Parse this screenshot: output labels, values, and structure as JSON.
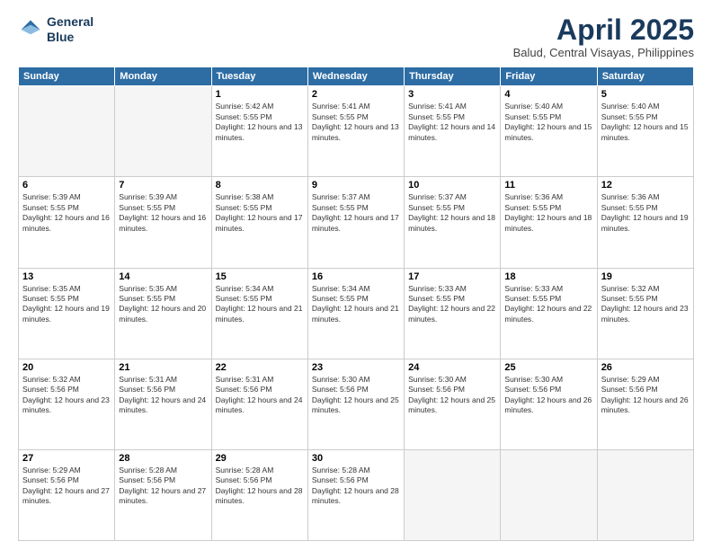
{
  "header": {
    "logo_line1": "General",
    "logo_line2": "Blue",
    "title": "April 2025",
    "subtitle": "Balud, Central Visayas, Philippines"
  },
  "calendar": {
    "days_of_week": [
      "Sunday",
      "Monday",
      "Tuesday",
      "Wednesday",
      "Thursday",
      "Friday",
      "Saturday"
    ],
    "weeks": [
      [
        {
          "day": "",
          "sunrise": "",
          "sunset": "",
          "daylight": "",
          "empty": true
        },
        {
          "day": "",
          "sunrise": "",
          "sunset": "",
          "daylight": "",
          "empty": true
        },
        {
          "day": "1",
          "sunrise": "Sunrise: 5:42 AM",
          "sunset": "Sunset: 5:55 PM",
          "daylight": "Daylight: 12 hours and 13 minutes.",
          "empty": false
        },
        {
          "day": "2",
          "sunrise": "Sunrise: 5:41 AM",
          "sunset": "Sunset: 5:55 PM",
          "daylight": "Daylight: 12 hours and 13 minutes.",
          "empty": false
        },
        {
          "day": "3",
          "sunrise": "Sunrise: 5:41 AM",
          "sunset": "Sunset: 5:55 PM",
          "daylight": "Daylight: 12 hours and 14 minutes.",
          "empty": false
        },
        {
          "day": "4",
          "sunrise": "Sunrise: 5:40 AM",
          "sunset": "Sunset: 5:55 PM",
          "daylight": "Daylight: 12 hours and 15 minutes.",
          "empty": false
        },
        {
          "day": "5",
          "sunrise": "Sunrise: 5:40 AM",
          "sunset": "Sunset: 5:55 PM",
          "daylight": "Daylight: 12 hours and 15 minutes.",
          "empty": false
        }
      ],
      [
        {
          "day": "6",
          "sunrise": "Sunrise: 5:39 AM",
          "sunset": "Sunset: 5:55 PM",
          "daylight": "Daylight: 12 hours and 16 minutes.",
          "empty": false
        },
        {
          "day": "7",
          "sunrise": "Sunrise: 5:39 AM",
          "sunset": "Sunset: 5:55 PM",
          "daylight": "Daylight: 12 hours and 16 minutes.",
          "empty": false
        },
        {
          "day": "8",
          "sunrise": "Sunrise: 5:38 AM",
          "sunset": "Sunset: 5:55 PM",
          "daylight": "Daylight: 12 hours and 17 minutes.",
          "empty": false
        },
        {
          "day": "9",
          "sunrise": "Sunrise: 5:37 AM",
          "sunset": "Sunset: 5:55 PM",
          "daylight": "Daylight: 12 hours and 17 minutes.",
          "empty": false
        },
        {
          "day": "10",
          "sunrise": "Sunrise: 5:37 AM",
          "sunset": "Sunset: 5:55 PM",
          "daylight": "Daylight: 12 hours and 18 minutes.",
          "empty": false
        },
        {
          "day": "11",
          "sunrise": "Sunrise: 5:36 AM",
          "sunset": "Sunset: 5:55 PM",
          "daylight": "Daylight: 12 hours and 18 minutes.",
          "empty": false
        },
        {
          "day": "12",
          "sunrise": "Sunrise: 5:36 AM",
          "sunset": "Sunset: 5:55 PM",
          "daylight": "Daylight: 12 hours and 19 minutes.",
          "empty": false
        }
      ],
      [
        {
          "day": "13",
          "sunrise": "Sunrise: 5:35 AM",
          "sunset": "Sunset: 5:55 PM",
          "daylight": "Daylight: 12 hours and 19 minutes.",
          "empty": false
        },
        {
          "day": "14",
          "sunrise": "Sunrise: 5:35 AM",
          "sunset": "Sunset: 5:55 PM",
          "daylight": "Daylight: 12 hours and 20 minutes.",
          "empty": false
        },
        {
          "day": "15",
          "sunrise": "Sunrise: 5:34 AM",
          "sunset": "Sunset: 5:55 PM",
          "daylight": "Daylight: 12 hours and 21 minutes.",
          "empty": false
        },
        {
          "day": "16",
          "sunrise": "Sunrise: 5:34 AM",
          "sunset": "Sunset: 5:55 PM",
          "daylight": "Daylight: 12 hours and 21 minutes.",
          "empty": false
        },
        {
          "day": "17",
          "sunrise": "Sunrise: 5:33 AM",
          "sunset": "Sunset: 5:55 PM",
          "daylight": "Daylight: 12 hours and 22 minutes.",
          "empty": false
        },
        {
          "day": "18",
          "sunrise": "Sunrise: 5:33 AM",
          "sunset": "Sunset: 5:55 PM",
          "daylight": "Daylight: 12 hours and 22 minutes.",
          "empty": false
        },
        {
          "day": "19",
          "sunrise": "Sunrise: 5:32 AM",
          "sunset": "Sunset: 5:55 PM",
          "daylight": "Daylight: 12 hours and 23 minutes.",
          "empty": false
        }
      ],
      [
        {
          "day": "20",
          "sunrise": "Sunrise: 5:32 AM",
          "sunset": "Sunset: 5:56 PM",
          "daylight": "Daylight: 12 hours and 23 minutes.",
          "empty": false
        },
        {
          "day": "21",
          "sunrise": "Sunrise: 5:31 AM",
          "sunset": "Sunset: 5:56 PM",
          "daylight": "Daylight: 12 hours and 24 minutes.",
          "empty": false
        },
        {
          "day": "22",
          "sunrise": "Sunrise: 5:31 AM",
          "sunset": "Sunset: 5:56 PM",
          "daylight": "Daylight: 12 hours and 24 minutes.",
          "empty": false
        },
        {
          "day": "23",
          "sunrise": "Sunrise: 5:30 AM",
          "sunset": "Sunset: 5:56 PM",
          "daylight": "Daylight: 12 hours and 25 minutes.",
          "empty": false
        },
        {
          "day": "24",
          "sunrise": "Sunrise: 5:30 AM",
          "sunset": "Sunset: 5:56 PM",
          "daylight": "Daylight: 12 hours and 25 minutes.",
          "empty": false
        },
        {
          "day": "25",
          "sunrise": "Sunrise: 5:30 AM",
          "sunset": "Sunset: 5:56 PM",
          "daylight": "Daylight: 12 hours and 26 minutes.",
          "empty": false
        },
        {
          "day": "26",
          "sunrise": "Sunrise: 5:29 AM",
          "sunset": "Sunset: 5:56 PM",
          "daylight": "Daylight: 12 hours and 26 minutes.",
          "empty": false
        }
      ],
      [
        {
          "day": "27",
          "sunrise": "Sunrise: 5:29 AM",
          "sunset": "Sunset: 5:56 PM",
          "daylight": "Daylight: 12 hours and 27 minutes.",
          "empty": false
        },
        {
          "day": "28",
          "sunrise": "Sunrise: 5:28 AM",
          "sunset": "Sunset: 5:56 PM",
          "daylight": "Daylight: 12 hours and 27 minutes.",
          "empty": false
        },
        {
          "day": "29",
          "sunrise": "Sunrise: 5:28 AM",
          "sunset": "Sunset: 5:56 PM",
          "daylight": "Daylight: 12 hours and 28 minutes.",
          "empty": false
        },
        {
          "day": "30",
          "sunrise": "Sunrise: 5:28 AM",
          "sunset": "Sunset: 5:56 PM",
          "daylight": "Daylight: 12 hours and 28 minutes.",
          "empty": false
        },
        {
          "day": "",
          "sunrise": "",
          "sunset": "",
          "daylight": "",
          "empty": true
        },
        {
          "day": "",
          "sunrise": "",
          "sunset": "",
          "daylight": "",
          "empty": true
        },
        {
          "day": "",
          "sunrise": "",
          "sunset": "",
          "daylight": "",
          "empty": true
        }
      ]
    ]
  }
}
